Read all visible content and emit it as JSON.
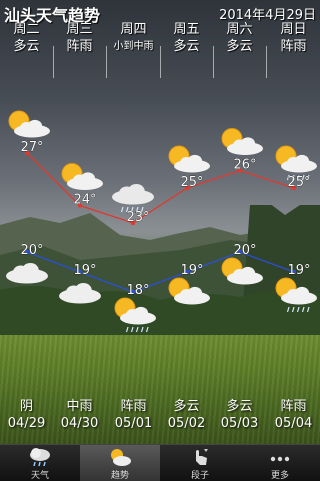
{
  "app": {
    "title": "汕头天气趋势",
    "date": "2014年4月29日"
  },
  "days": [
    {
      "weekday": "周二",
      "condition": "多云",
      "date": "04/29",
      "bottom_condition": "阴",
      "high": 27,
      "low": 20,
      "day_icon": "sun-cloud-icon",
      "night_icon": "cloud-icon"
    },
    {
      "weekday": "周三",
      "condition": "阵雨",
      "date": "04/30",
      "bottom_condition": "中雨",
      "high": 24,
      "low": 19,
      "day_icon": "sun-cloud-icon",
      "night_icon": "cloud-icon"
    },
    {
      "weekday": "周四",
      "condition": "小到中雨",
      "date": "05/01",
      "bottom_condition": "阵雨",
      "high": 23,
      "low": 18,
      "day_icon": "rain-cloud-icon",
      "night_icon": "sun-rain-icon"
    },
    {
      "weekday": "周五",
      "condition": "多云",
      "date": "05/02",
      "bottom_condition": "多云",
      "high": 25,
      "low": 19,
      "day_icon": "sun-cloud-icon",
      "night_icon": "sun-cloud-icon"
    },
    {
      "weekday": "周六",
      "condition": "多云",
      "date": "05/03",
      "bottom_condition": "多云",
      "high": 26,
      "low": 20,
      "day_icon": "sun-cloud-icon",
      "night_icon": "sun-cloud-icon"
    },
    {
      "weekday": "周日",
      "condition": "阵雨",
      "date": "05/04",
      "bottom_condition": "阵雨",
      "high": 25,
      "low": 19,
      "day_icon": "sun-rain-icon",
      "night_icon": "sun-rain-icon"
    }
  ],
  "colors": {
    "high_line": "#e0392f",
    "low_line": "#2a4fd8"
  },
  "tabs": [
    {
      "label": "天气",
      "icon": "cloud-rain-icon",
      "active": false
    },
    {
      "label": "趋势",
      "icon": "sun-cloud-icon",
      "active": true
    },
    {
      "label": "段子",
      "icon": "hand-pointer-icon",
      "active": false
    },
    {
      "label": "更多",
      "icon": "more-dots-icon",
      "active": false
    }
  ]
}
